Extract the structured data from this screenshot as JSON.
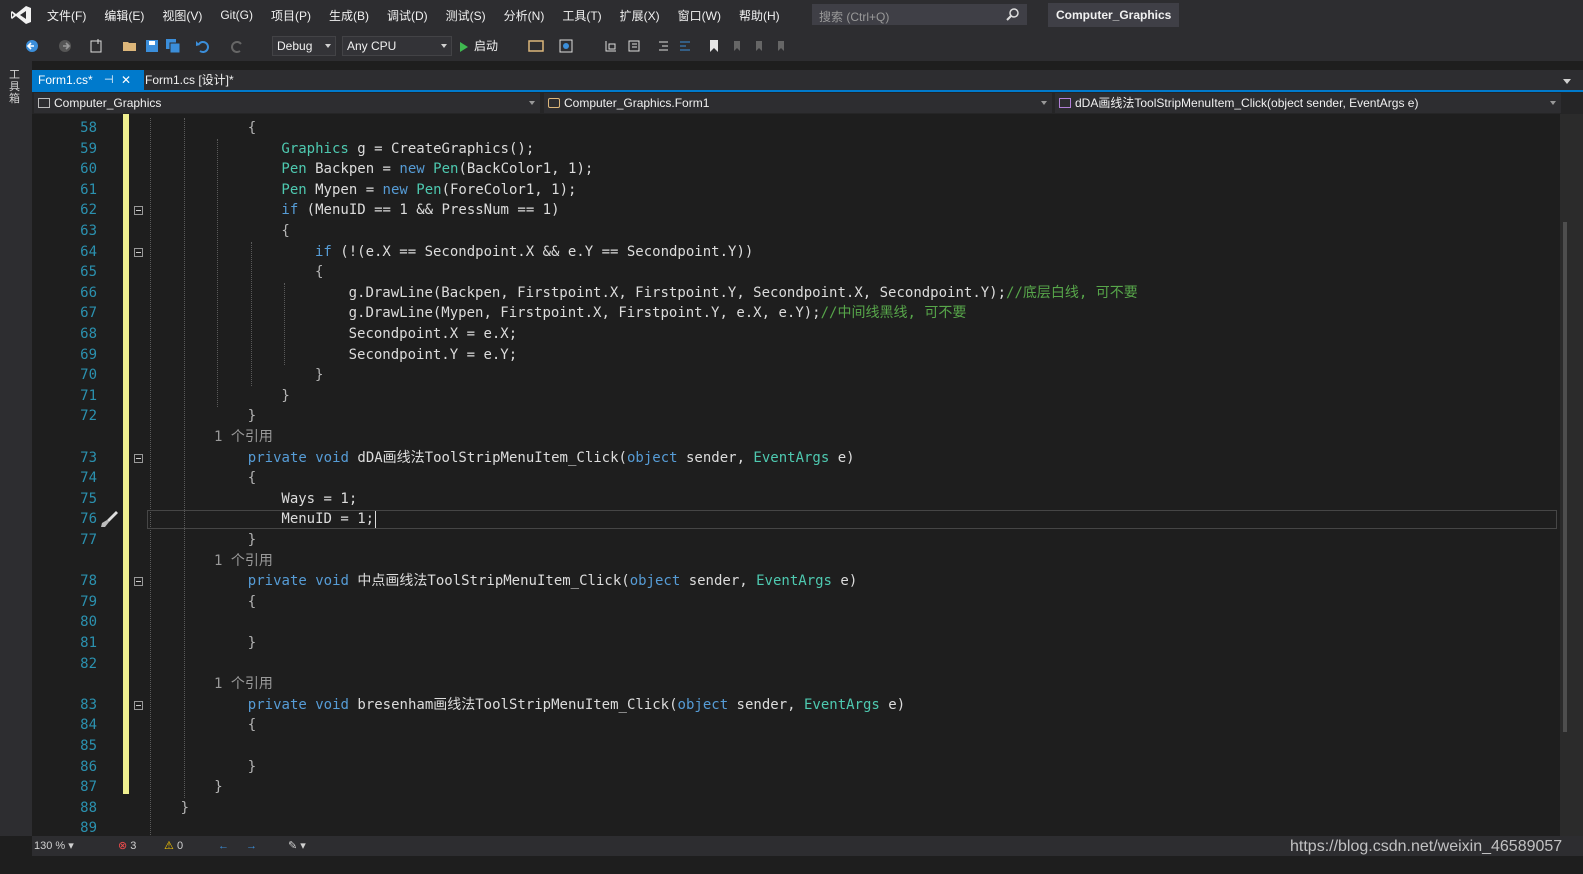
{
  "menubar": {
    "items": [
      "文件(F)",
      "编辑(E)",
      "视图(V)",
      "Git(G)",
      "项目(P)",
      "生成(B)",
      "调试(D)",
      "测试(S)",
      "分析(N)",
      "工具(T)",
      "扩展(X)",
      "窗口(W)",
      "帮助(H)"
    ],
    "search_placeholder": "搜索 (Ctrl+Q)",
    "solution_title": "Computer_Graphics"
  },
  "toolbar": {
    "config": "Debug",
    "platform": "Any CPU",
    "start_label": "启动"
  },
  "toolstrip": {
    "label": "工具箱"
  },
  "tabs": [
    {
      "label": "Form1.cs*",
      "active": true
    },
    {
      "label": "Form1.cs [设计]*",
      "active": false
    }
  ],
  "navbar": {
    "project": "Computer_Graphics",
    "class": "Computer_Graphics.Form1",
    "member": "dDA画线法ToolStripMenuItem_Click(object sender, EventArgs e)"
  },
  "editor": {
    "lines": [
      {
        "n": "58",
        "indent": 3,
        "t": [
          [
            "{",
            "pu"
          ]
        ]
      },
      {
        "n": "59",
        "indent": 4,
        "t": [
          [
            "Graphics",
            "ty"
          ],
          [
            " g = CreateGraphics();",
            ""
          ]
        ]
      },
      {
        "n": "60",
        "indent": 4,
        "t": [
          [
            "Pen",
            "ty"
          ],
          [
            " Backpen = ",
            ""
          ],
          [
            "new",
            "kw"
          ],
          [
            " ",
            ""
          ],
          [
            "Pen",
            "ty"
          ],
          [
            "(BackColor1, 1);",
            ""
          ]
        ]
      },
      {
        "n": "61",
        "indent": 4,
        "t": [
          [
            "Pen",
            "ty"
          ],
          [
            " Mypen = ",
            ""
          ],
          [
            "new",
            "kw"
          ],
          [
            " ",
            ""
          ],
          [
            "Pen",
            "ty"
          ],
          [
            "(ForeColor1, 1);",
            ""
          ]
        ]
      },
      {
        "n": "62",
        "indent": 4,
        "t": [
          [
            "if",
            "kw"
          ],
          [
            " (MenuID == 1 && PressNum == 1)",
            ""
          ]
        ],
        "fold": true
      },
      {
        "n": "63",
        "indent": 4,
        "t": [
          [
            "{",
            "pu"
          ]
        ]
      },
      {
        "n": "64",
        "indent": 5,
        "t": [
          [
            "if",
            "kw"
          ],
          [
            " (!(e.X == Secondpoint.X && e.Y == Secondpoint.Y))",
            ""
          ]
        ],
        "fold": true
      },
      {
        "n": "65",
        "indent": 5,
        "t": [
          [
            "{",
            "pu"
          ]
        ]
      },
      {
        "n": "66",
        "indent": 6,
        "t": [
          [
            "g.DrawLine(Backpen, Firstpoint.X, Firstpoint.Y, Secondpoint.X, Secondpoint.Y);",
            ""
          ],
          [
            "//底层白线, 可不要",
            "cm"
          ]
        ]
      },
      {
        "n": "67",
        "indent": 6,
        "t": [
          [
            "g.DrawLine(Mypen, Firstpoint.X, Firstpoint.Y, e.X, e.Y);",
            ""
          ],
          [
            "//中间线黑线, 可不要",
            "cm"
          ]
        ]
      },
      {
        "n": "68",
        "indent": 6,
        "t": [
          [
            "Secondpoint.X = e.X;",
            ""
          ]
        ]
      },
      {
        "n": "69",
        "indent": 6,
        "t": [
          [
            "Secondpoint.Y = e.Y;",
            ""
          ]
        ]
      },
      {
        "n": "70",
        "indent": 5,
        "t": [
          [
            "}",
            "pu"
          ]
        ]
      },
      {
        "n": "71",
        "indent": 4,
        "t": [
          [
            "}",
            "pu"
          ]
        ]
      },
      {
        "n": "72",
        "indent": 3,
        "t": [
          [
            "}",
            "pu"
          ]
        ]
      },
      {
        "lens": "1 个引用"
      },
      {
        "n": "73",
        "indent": 3,
        "t": [
          [
            "private",
            "kw"
          ],
          [
            " ",
            ""
          ],
          [
            "void",
            "kw"
          ],
          [
            " dDA画线法ToolStripMenuItem_Click(",
            ""
          ],
          [
            "object",
            "kw"
          ],
          [
            " sender, ",
            ""
          ],
          [
            "EventArgs",
            "ty"
          ],
          [
            " e)",
            ""
          ]
        ],
        "fold": true
      },
      {
        "n": "74",
        "indent": 3,
        "t": [
          [
            "{",
            "pu"
          ]
        ]
      },
      {
        "n": "75",
        "indent": 4,
        "t": [
          [
            "Ways = 1;",
            ""
          ]
        ]
      },
      {
        "n": "76",
        "indent": 4,
        "t": [
          [
            "MenuID = 1;",
            ""
          ]
        ],
        "current": true
      },
      {
        "n": "77",
        "indent": 3,
        "t": [
          [
            "}",
            "pu"
          ]
        ]
      },
      {
        "lens": "1 个引用"
      },
      {
        "n": "78",
        "indent": 3,
        "t": [
          [
            "private",
            "kw"
          ],
          [
            " ",
            ""
          ],
          [
            "void",
            "kw"
          ],
          [
            " 中点画线法ToolStripMenuItem_Click(",
            ""
          ],
          [
            "object",
            "kw"
          ],
          [
            " sender, ",
            ""
          ],
          [
            "EventArgs",
            "ty"
          ],
          [
            " e)",
            ""
          ]
        ],
        "fold": true
      },
      {
        "n": "79",
        "indent": 3,
        "t": [
          [
            "{",
            "pu"
          ]
        ]
      },
      {
        "n": "80",
        "indent": 3,
        "t": []
      },
      {
        "n": "81",
        "indent": 3,
        "t": [
          [
            "}",
            "pu"
          ]
        ]
      },
      {
        "n": "82",
        "indent": 3,
        "t": []
      },
      {
        "lens": "1 个引用"
      },
      {
        "n": "83",
        "indent": 3,
        "t": [
          [
            "private",
            "kw"
          ],
          [
            " ",
            ""
          ],
          [
            "void",
            "kw"
          ],
          [
            " bresenham画线法ToolStripMenuItem_Click(",
            ""
          ],
          [
            "object",
            "kw"
          ],
          [
            " sender, ",
            ""
          ],
          [
            "EventArgs",
            "ty"
          ],
          [
            " e)",
            ""
          ]
        ],
        "fold": true
      },
      {
        "n": "84",
        "indent": 3,
        "t": [
          [
            "{",
            "pu"
          ]
        ]
      },
      {
        "n": "85",
        "indent": 3,
        "t": []
      },
      {
        "n": "86",
        "indent": 3,
        "t": [
          [
            "}",
            "pu"
          ]
        ]
      },
      {
        "n": "87",
        "indent": 2,
        "t": [
          [
            "}",
            "pu"
          ]
        ]
      },
      {
        "n": "88",
        "indent": 1,
        "t": [
          [
            "}",
            "pu"
          ]
        ]
      },
      {
        "n": "89",
        "indent": 0,
        "t": []
      }
    ]
  },
  "status": {
    "zoom": "130 %",
    "errors": "3",
    "warnings": "0",
    "watermark": "https://blog.csdn.net/weixin_46589057"
  },
  "colors": {
    "accent": "#007acc",
    "change_marker": "#efef8f",
    "keyword": "#569cd6",
    "type": "#4ec9b0",
    "comment": "#57a64a",
    "line_number": "#2b91af"
  }
}
